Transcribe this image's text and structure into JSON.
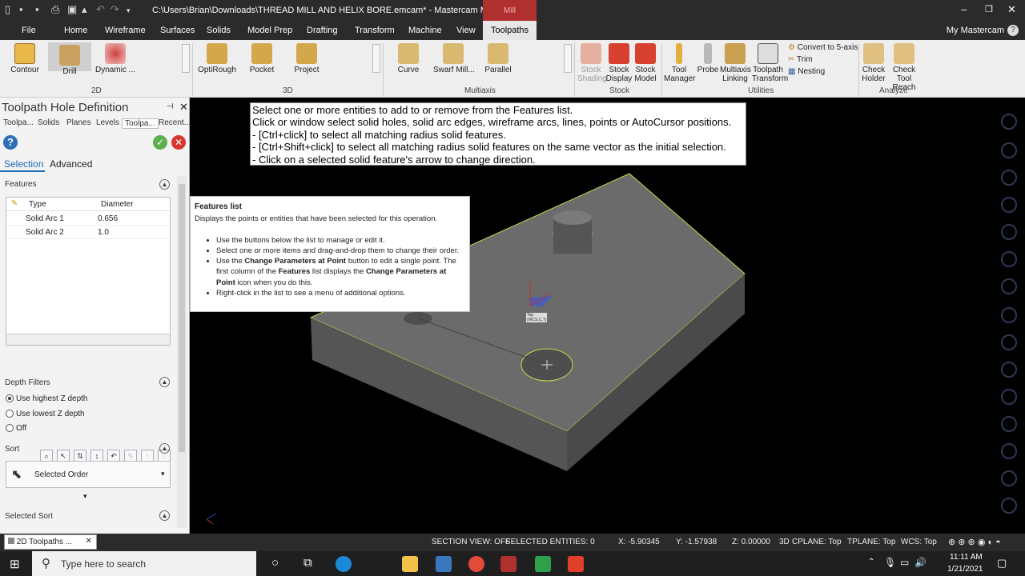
{
  "window": {
    "title": "C:\\Users\\Brian\\Downloads\\THREAD MILL AND HELIX BORE.emcam* - Mastercam Mill 2021",
    "context_tab": "Mill"
  },
  "menu": {
    "items": [
      "File",
      "Home",
      "Wireframe",
      "Surfaces",
      "Solids",
      "Model Prep",
      "Drafting",
      "Transform",
      "Machine",
      "View",
      "Toolpaths"
    ],
    "account": "My Mastercam"
  },
  "ribbon": {
    "g2d": {
      "label": "2D",
      "buttons": [
        "Contour",
        "Drill",
        "Dynamic ..."
      ]
    },
    "g3d": {
      "label": "3D",
      "buttons": [
        "OptiRough",
        "Pocket",
        "Project"
      ]
    },
    "multiaxis": {
      "label": "Multiaxis",
      "buttons": [
        "Curve",
        "Swarf Mill...",
        "Parallel"
      ]
    },
    "stock": {
      "label": "Stock",
      "buttons": [
        "Stock Shading",
        "Stock Display",
        "Stock Model"
      ]
    },
    "utilities": {
      "label": "Utilities",
      "buttons": [
        "Tool Manager",
        "Probe",
        "Multiaxis Linking",
        "Toolpath Transform"
      ],
      "small": [
        "Convert to 5-axis",
        "Trim",
        "Nesting"
      ]
    },
    "analyze": {
      "label": "Analyze",
      "buttons": [
        "Check Holder",
        "Check Tool Reach"
      ]
    }
  },
  "panel": {
    "title": "Toolpath Hole Definition",
    "tabs": [
      "Toolpa...",
      "Solids",
      "Planes",
      "Levels",
      "Toolpa...",
      "Recent..."
    ],
    "subtabs": [
      "Selection",
      "Advanced"
    ],
    "features": {
      "label": "Features",
      "columns": [
        "Type",
        "Diameter"
      ],
      "rows": [
        {
          "type": "Solid Arc 1",
          "diameter": "0.656"
        },
        {
          "type": "Solid Arc 2",
          "diameter": "1.0"
        }
      ]
    },
    "depth_filters": {
      "label": "Depth Filters",
      "options": [
        "Use highest Z depth",
        "Use lowest Z depth",
        "Off"
      ],
      "selected": 0
    },
    "sort": {
      "label": "Sort",
      "value": "Selected Order"
    },
    "selected_sort": {
      "label": "Selected Sort"
    }
  },
  "tooltip_main": {
    "lines": [
      "Select one or more entities to add to or remove from the Features list.",
      "Click or window select solid holes, solid arc edges, wireframe arcs, lines, points or AutoCursor positions.",
      "- [Ctrl+click] to select all matching radius solid features.",
      "- [Ctrl+Shift+click] to select all matching radius solid features on the same vector as the initial selection.",
      "- Click on a selected solid feature's arrow to change direction."
    ]
  },
  "tooltip_features": {
    "title": "Features list",
    "desc": "Displays the points or entities that have been selected for this operation.",
    "b1": "Use the buttons below the list to manage or edit it.",
    "b2": "Select one or more items and drag-and-drop them to change their order.",
    "b3a": "Use the ",
    "b3b": "Change Parameters at Point",
    "b3c": " button to edit a single point. The first column of the ",
    "b3d": "Features",
    "b3e": " list displays the ",
    "b3f": "Change Parameters at Point",
    "b3g": " icon when you do this.",
    "b4": "Right-click in the list to see a menu of additional options."
  },
  "viewport": {
    "plane_label": "Top (WCS,C,T)"
  },
  "status": {
    "section_view": "SECTION VIEW: OFF",
    "selected": "SELECTED ENTITIES: 0",
    "x": "X:   -5.90345",
    "y": "Y:   -1.57938",
    "z": "Z:  0.00000",
    "mode": "3D",
    "cplane": "CPLANE: Top",
    "tplane": "TPLANE: Top",
    "wcs": "WCS: Top"
  },
  "taskbar": {
    "app_tab": "2D Toolpaths ...",
    "search": "Type here to search",
    "time": "11:11 AM",
    "date": "1/21/2021"
  },
  "colors": {
    "accent": "#b03030",
    "dark": "#2b2b2b",
    "part": "#6b6b6b",
    "edge": "#c8d84a"
  }
}
